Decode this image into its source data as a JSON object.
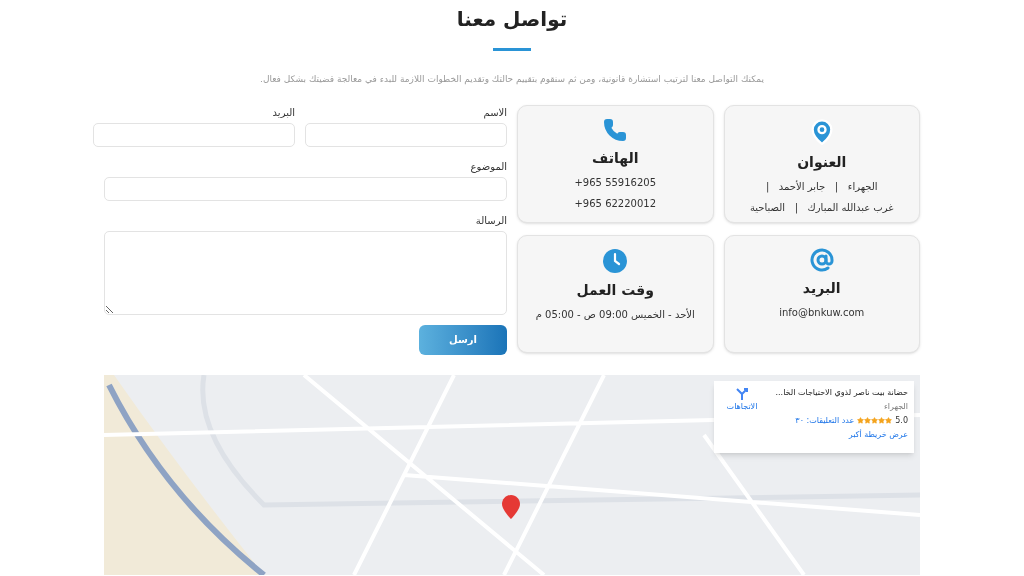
{
  "header": {
    "title": "تواصل معنا",
    "subtitle": "يمكنك التواصل معنا لترتيب استشارة قانونية، ومن ثم سنقوم بتقييم حالتك وتقديم الخطوات اللازمة للبدء في معالجة قضيتك بشكل فعال."
  },
  "info_cards": [
    {
      "kind": "address",
      "title": "العنوان",
      "lines": [
        "الجهراء   |   جابر الأحمد   |",
        "غرب عبدالله المبارك   |   الصباحية"
      ]
    },
    {
      "kind": "phone",
      "title": "الهاتف",
      "lines": [
        "+965 55916205",
        "+965 62220012"
      ]
    },
    {
      "kind": "email",
      "title": "البريد",
      "lines": [
        "info@bnkuw.com"
      ]
    },
    {
      "kind": "hours",
      "title": "وقت العمل",
      "lines": [
        "الأحد - الخميس 09:00 ص - 05:00 م"
      ]
    }
  ],
  "form": {
    "fields": [
      {
        "kind": "text",
        "label": "الاسم"
      },
      {
        "kind": "text",
        "label": "البريد"
      },
      {
        "kind": "text",
        "label": "الموضوع"
      },
      {
        "kind": "textarea",
        "label": "الرسالة"
      }
    ],
    "submit": "ارسل"
  },
  "map": {
    "place_card": {
      "name": "حضانة بيت ناصر لذوي الاحتياجات الخا...",
      "area": "الجهراء",
      "rating": "5.0",
      "stars": 5,
      "reviews": "عدد التعليقات: ٣٠",
      "larger_map": "عرض خريطة أكبر",
      "directions": "الاتجاهات"
    }
  }
}
